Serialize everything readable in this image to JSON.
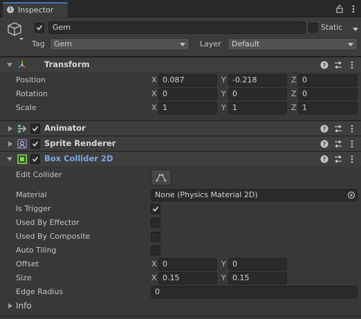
{
  "tab": {
    "label": "Inspector"
  },
  "header": {
    "object_name": "Gem",
    "active": true,
    "static_label": "Static",
    "static_checked": false,
    "tag_label": "Tag",
    "tag_value": "Gem",
    "layer_label": "Layer",
    "layer_value": "Default"
  },
  "components": {
    "transform": {
      "title": "Transform",
      "rows": [
        {
          "label": "Position",
          "x": "0.087",
          "y": "-0.218",
          "z": "0"
        },
        {
          "label": "Rotation",
          "x": "0",
          "y": "0",
          "z": "0"
        },
        {
          "label": "Scale",
          "x": "1",
          "y": "1",
          "z": "1"
        }
      ]
    },
    "animator": {
      "title": "Animator",
      "enabled": true
    },
    "sprite_renderer": {
      "title": "Sprite Renderer",
      "enabled": true
    },
    "box_collider": {
      "title": "Box Collider 2D",
      "enabled": true,
      "edit_collider_label": "Edit Collider",
      "material_label": "Material",
      "material_value": "None (Physics Material 2D)",
      "is_trigger_label": "Is Trigger",
      "is_trigger": true,
      "used_by_effector_label": "Used By Effector",
      "used_by_effector": false,
      "used_by_composite_label": "Used By Composite",
      "used_by_composite": false,
      "auto_tiling_label": "Auto Tiling",
      "auto_tiling": false,
      "offset_label": "Offset",
      "offset_x": "0",
      "offset_y": "0",
      "size_label": "Size",
      "size_x": "0.15",
      "size_y": "0.15",
      "edge_radius_label": "Edge Radius",
      "edge_radius": "0",
      "info_label": "Info"
    }
  },
  "axes": {
    "x": "X",
    "y": "Y",
    "z": "Z"
  },
  "colors": {
    "accent": "#3a79bb",
    "collider_title": "#7da7e8",
    "checkmark": "#d8d8d8"
  }
}
